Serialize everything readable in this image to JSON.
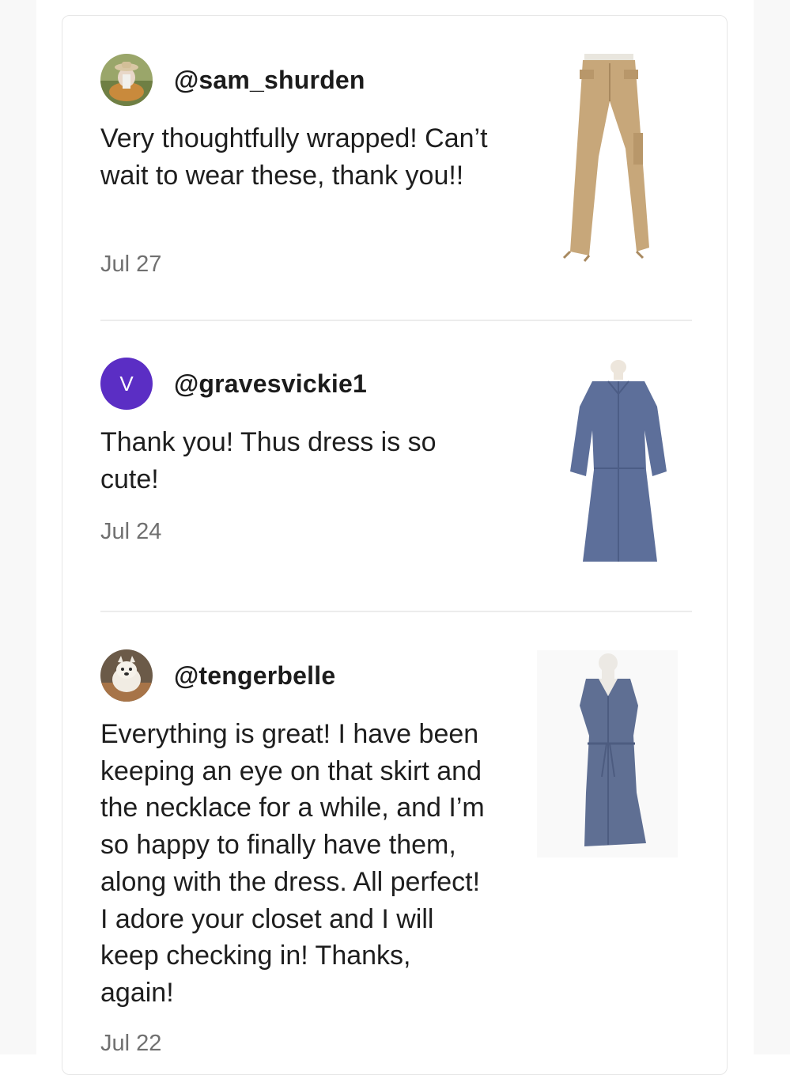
{
  "reviews": [
    {
      "username": "@sam_shurden",
      "avatar": "photo-avatar-person",
      "text": "Very thoughtfully wrapped! Can’t wait to wear these, thank you!!",
      "date": "Jul 27",
      "product": "tan-cargo-pants-thumbnail"
    },
    {
      "username": "@gravesvickie1",
      "avatar_letter": "V",
      "avatar_color": "#5b2ec4",
      "text": "Thank you! Thus dress is so cute!",
      "date": "Jul 24",
      "product": "chambray-shirt-dress-thumbnail"
    },
    {
      "username": "@tengerbelle",
      "avatar": "photo-avatar-dog",
      "text": "Everything is great! I have been keeping an eye on that skirt and the necklace for a while, and I’m so happy to fi­nally have them, along with the dress. All perfect! I adore your closet and I will keep checking in! Thanks, again!",
      "date": "Jul 22",
      "product": "sleeveless-chambray-dress-thumbnail"
    }
  ]
}
